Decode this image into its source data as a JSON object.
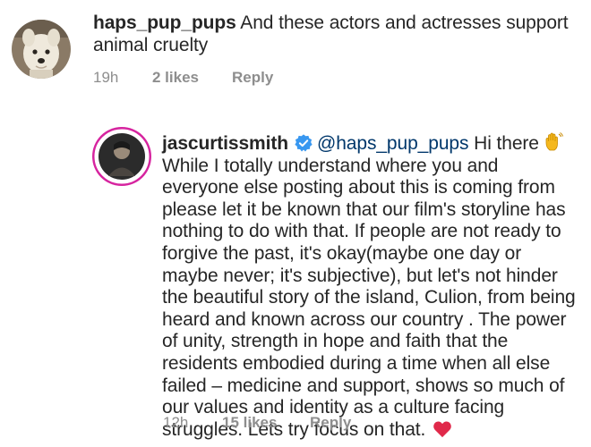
{
  "comments": [
    {
      "username": "haps_pup_pups",
      "text": "And these actors and actresses support animal cruelty",
      "time": "19h",
      "likes": "2 likes",
      "reply": "Reply",
      "avatar_icon": "dog-photo-avatar"
    },
    {
      "username": "jascurtissmith",
      "verified": true,
      "mention": "@haps_pup_pups",
      "greeting": "Hi there",
      "greeting_emoji": "waving-hand-icon",
      "text": "While I totally understand where you and everyone else posting about this is coming from please let it be known that our film's storyline has nothing to do with that. If people are not ready to forgive the past, it's okay(maybe one day or maybe never; it's subjective), but let's not hinder the beautiful story of the island, Culion, from being heard and known across our country . The power of unity, strength in hope and faith that the residents embodied during a time when all else failed – medicine and support, shows so much of our values and identity as a culture facing struggles. Lets try focus on that.",
      "end_emoji": "red-heart-icon",
      "time": "12h",
      "likes": "15 likes",
      "reply": "Reply",
      "avatar_icon": "portrait-photo-avatar-with-story-ring"
    }
  ],
  "colors": {
    "text": "#262626",
    "meta": "#8e8e8e",
    "mention": "#00376b",
    "verified": "#3897f0",
    "heart": "#ed4956"
  }
}
